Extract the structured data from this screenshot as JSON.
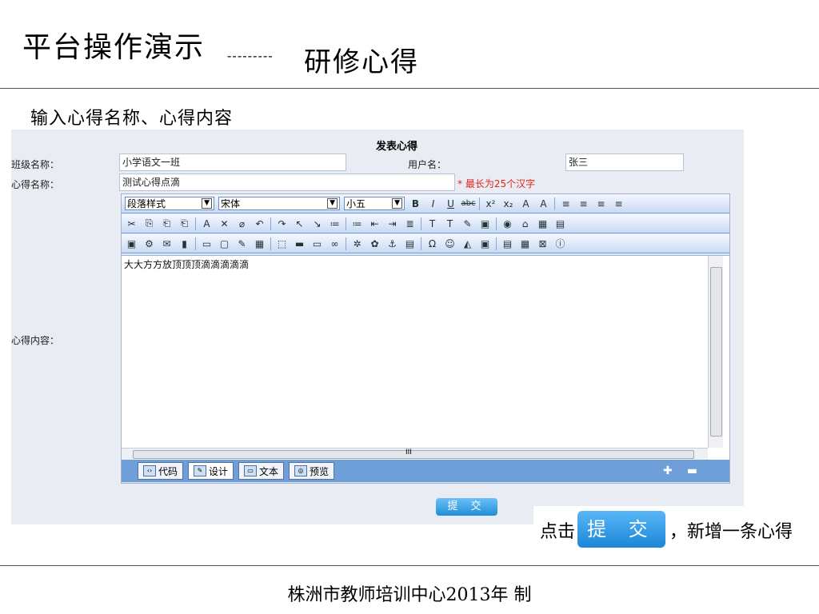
{
  "slide": {
    "title": "平台操作演示",
    "dashes": "---------",
    "subtitle": "研修心得",
    "instruction": "输入心得名称、心得内容",
    "footer": "株洲市教师培训中心2013年 制"
  },
  "form": {
    "title": "发表心得",
    "class_label": "班级名称：",
    "class_value": "小学语文一班",
    "user_label": "用户名：",
    "user_value": "张三",
    "name_label": "心得名称：",
    "name_value": "测试心得点滴",
    "name_hint": "* 最长为25个汉字",
    "content_label": "心得内容：",
    "submit_label": "提 交"
  },
  "editor": {
    "paragraph_style": "段落样式",
    "font": "宋体",
    "size": "小五",
    "content_text": "大大方方放顶顶顶滴滴滴滴滴",
    "scroll_marker": "III",
    "modes": [
      {
        "label": "代码"
      },
      {
        "label": "设计"
      },
      {
        "label": "文本"
      },
      {
        "label": "预览"
      }
    ],
    "toolbar_row1": [
      "B",
      "I",
      "U",
      "abc",
      "x²",
      "x₂",
      "A",
      "A",
      "≡",
      "≡",
      "≡",
      "≡"
    ],
    "toolbar_row2": [
      "✂",
      "⎘",
      "⎗",
      "⎗",
      "A",
      "✕",
      "⌀",
      "↶",
      "↷",
      "↖",
      "↘",
      "≔",
      "≔",
      "⇤",
      "⇥",
      "≣",
      "T",
      "T",
      "✎",
      "▣",
      "◉",
      "⌂",
      "▦",
      "▤"
    ],
    "toolbar_row3": [
      "▣",
      "⚙",
      "✉",
      "▮",
      "▭",
      "▢",
      "✎",
      "▦",
      "⬚",
      "▬",
      "▭",
      "∞",
      "✲",
      "✿",
      "⚓",
      "▤",
      "Ω",
      "☺",
      "◭",
      "▣",
      "▤",
      "▦",
      "⊠",
      "ⓘ"
    ]
  },
  "callout": {
    "prefix": "点击",
    "button": "提 交",
    "suffix": "，新增一条心得"
  },
  "colors": {
    "accent": "#1f8fd8",
    "hint_red": "#e2231a",
    "toolbar_blue": "#6f9fd9"
  }
}
